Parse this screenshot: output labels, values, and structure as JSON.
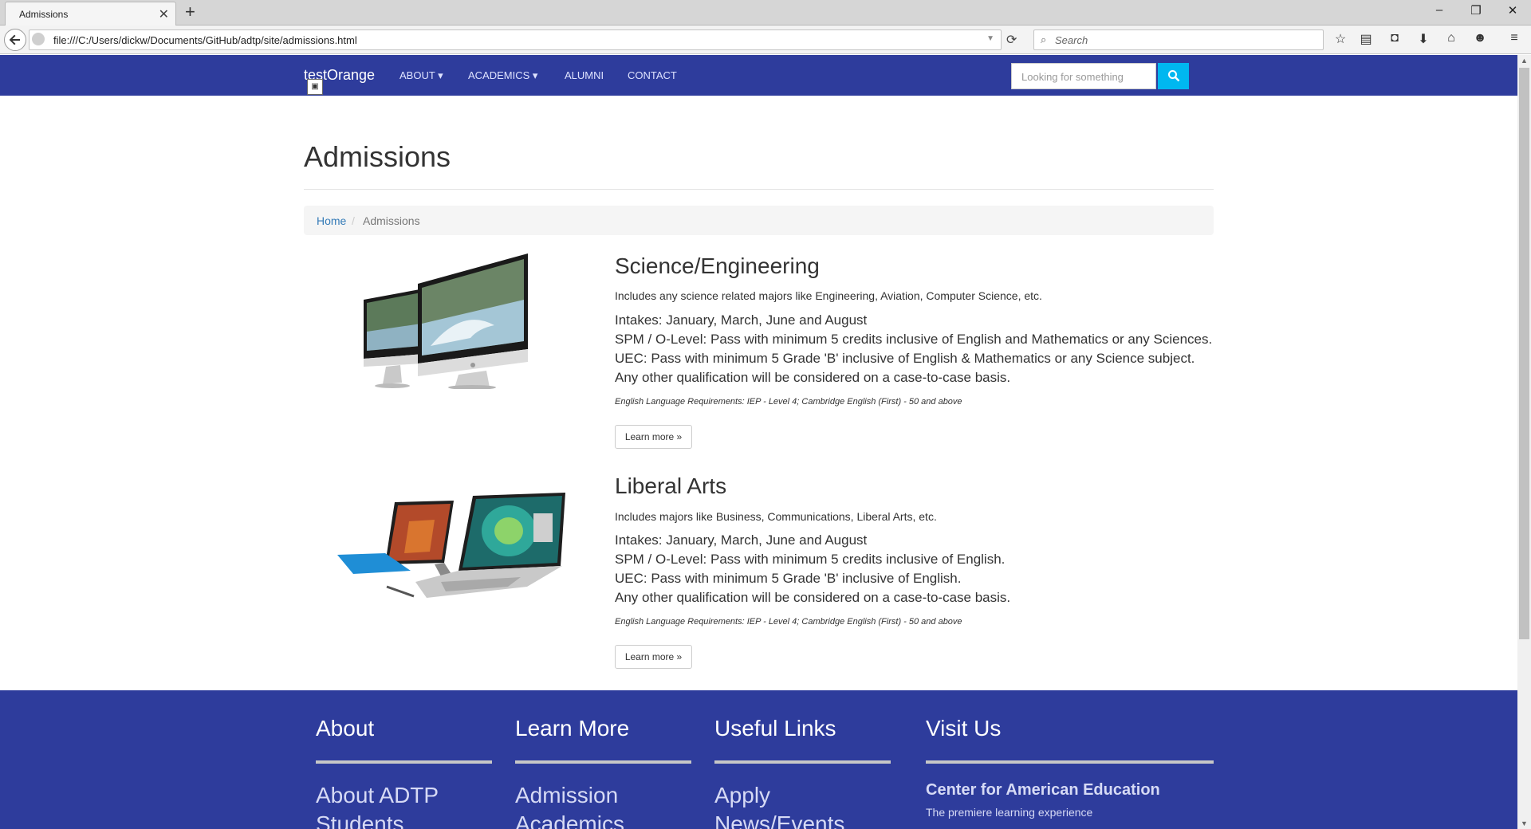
{
  "browser": {
    "tab_title": "Admissions",
    "tab_close": "✕",
    "new_tab": "+",
    "url": "file:///C:/Users/dickw/Documents/GitHub/adtp/site/admissions.html",
    "search_placeholder": "Search",
    "window_controls": {
      "minimize": "–",
      "restore": "❐",
      "close": "✕"
    },
    "toolbar_icons": [
      "star-icon",
      "reader-icon",
      "pocket-icon",
      "download-icon",
      "home-icon",
      "chat-icon",
      "menu-icon"
    ]
  },
  "site_nav": {
    "brand": "testOrange",
    "links": [
      "ABOUT",
      "ACADEMICS",
      "ALUMNI",
      "CONTACT"
    ],
    "search_placeholder": "Looking for something"
  },
  "page": {
    "title": "Admissions",
    "breadcrumb": {
      "home": "Home",
      "separator": "/",
      "current": "Admissions"
    }
  },
  "sections": [
    {
      "title": "Science/Engineering",
      "lead": "Includes any science related majors like Engineering, Aviation, Computer Science, etc.",
      "lines": [
        "Intakes: January, March, June and August",
        "SPM / O-Level: Pass with minimum 5 credits inclusive of English and Mathematics or any Sciences.",
        "UEC: Pass with minimum 5 Grade 'B' inclusive of English & Mathematics or any Science subject.",
        "Any other qualification will be considered on a case-to-case basis."
      ],
      "requirement": "English Language Requirements: IEP - Level 4; Cambridge English (First) - 50 and above",
      "button": "Learn more »"
    },
    {
      "title": "Liberal Arts",
      "lead": "Includes majors like Business, Communications, Liberal Arts, etc.",
      "lines": [
        "Intakes: January, March, June and August",
        "SPM / O-Level: Pass with minimum 5 credits inclusive of English.",
        "UEC: Pass with minimum 5 Grade 'B' inclusive of English.",
        "Any other qualification will be considered on a case-to-case basis."
      ],
      "requirement": "English Language Requirements: IEP - Level 4; Cambridge English (First) - 50 and above",
      "button": "Learn more »"
    }
  ],
  "footer": {
    "columns": [
      {
        "heading": "About",
        "links": [
          "About ADTP",
          "Students"
        ]
      },
      {
        "heading": "Learn More",
        "links": [
          "Admission",
          "Academics"
        ]
      },
      {
        "heading": "Useful Links",
        "links": [
          "Apply",
          "News/Events"
        ]
      },
      {
        "heading": "Visit Us",
        "strong": "Center for American Education",
        "sub": "The premiere learning experience"
      }
    ]
  },
  "colors": {
    "nav_bg": "#2e3c9c",
    "search_btn": "#00b7f0",
    "link": "#337ab7"
  }
}
